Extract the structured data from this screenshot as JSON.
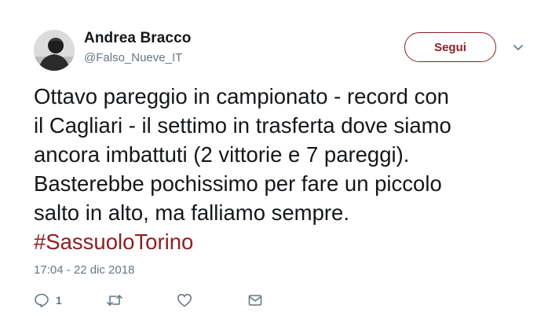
{
  "author": {
    "name": "Andrea Bracco",
    "handle": "@Falso_Nueve_IT",
    "avatar_icon": "user-photo-avatar"
  },
  "follow_button": {
    "label": "Segui"
  },
  "menu_icon": "chevron-down-icon",
  "tweet": {
    "lines": [
      "Ottavo pareggio in campionato - record con",
      "il Cagliari - il settimo in trasferta dove siamo",
      "ancora imbattuti (2 vittorie e 7 pareggi).",
      "Basterebbe pochissimo per fare un piccolo",
      "salto in alto, ma falliamo sempre."
    ],
    "hashtag": "#SassuoloTorino"
  },
  "timestamp": "17:04 - 22 dic 2018",
  "actions": {
    "reply": {
      "icon": "reply-icon",
      "count": "1"
    },
    "retweet": {
      "icon": "retweet-icon"
    },
    "like": {
      "icon": "heart-icon"
    },
    "message": {
      "icon": "envelope-icon"
    }
  },
  "colors": {
    "accent": "#8f1e22",
    "text": "#14171a",
    "secondary": "#657786"
  }
}
